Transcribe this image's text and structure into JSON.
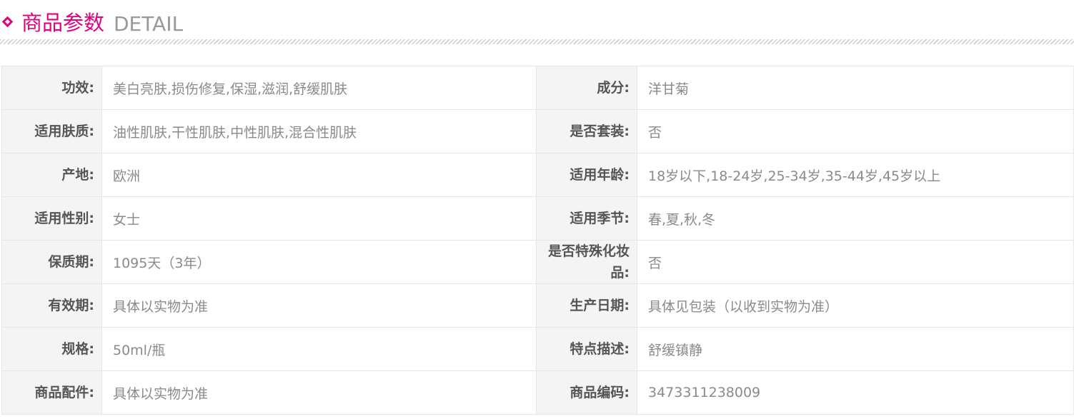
{
  "header": {
    "title_cn": "商品参数",
    "title_en": "DETAIL",
    "accent_color": "#e4007f",
    "icon": "diamond-icon"
  },
  "params": {
    "rows": [
      {
        "left_label": "功效:",
        "left_value": "美白亮肤,损伤修复,保湿,滋润,舒缓肌肤",
        "right_label": "成分:",
        "right_value": "洋甘菊"
      },
      {
        "left_label": "适用肤质:",
        "left_value": "油性肌肤,干性肌肤,中性肌肤,混合性肌肤",
        "right_label": "是否套装:",
        "right_value": "否"
      },
      {
        "left_label": "产地:",
        "left_value": "欧洲",
        "right_label": "适用年龄:",
        "right_value": "18岁以下,18-24岁,25-34岁,35-44岁,45岁以上"
      },
      {
        "left_label": "适用性别:",
        "left_value": "女士",
        "right_label": "适用季节:",
        "right_value": "春,夏,秋,冬"
      },
      {
        "left_label": "保质期:",
        "left_value": "1095天（3年）",
        "right_label": "是否特殊化妆品:",
        "right_value": "否"
      },
      {
        "left_label": "有效期:",
        "left_value": "具体以实物为准",
        "right_label": "生产日期:",
        "right_value": "具体见包装（以收到实物为准）"
      },
      {
        "left_label": "规格:",
        "left_value": "50ml/瓶",
        "right_label": "特点描述:",
        "right_value": "舒缓镇静"
      },
      {
        "left_label": "商品配件:",
        "left_value": "具体以实物为准",
        "right_label": "商品编码:",
        "right_value": "3473311238009"
      }
    ]
  }
}
